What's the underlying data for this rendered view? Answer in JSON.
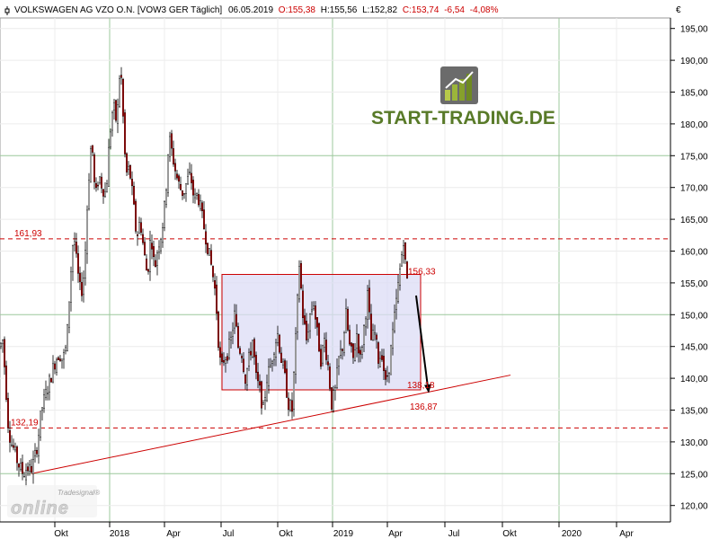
{
  "header": {
    "icon": "chart-icon",
    "instrument": "VOLKSWAGEN AG VZO O.N. [VOW3 GER  Täglich]",
    "date": "06.05.2019",
    "open": "O:155,38",
    "high": "H:155,56",
    "low": "L:152,82",
    "close": "C:153,74",
    "change": "-6,54",
    "change_pct": "-4,08%"
  },
  "currency_symbol": "€",
  "logo": {
    "text": "START-TRADING.DE"
  },
  "watermark": {
    "small": "Tradesignal®",
    "big": "online"
  },
  "colors": {
    "candle_up": "#ffffff",
    "candle_down": "#cc0000",
    "level": "#cc0000",
    "channel_fill": "#dcdcf5",
    "arrow": "#000000"
  },
  "chart_data": {
    "type": "candlestick",
    "ylim": [
      118,
      198
    ],
    "y_ticks": [
      "120,00",
      "125,00",
      "130,00",
      "135,00",
      "140,00",
      "145,00",
      "150,00",
      "155,00",
      "160,00",
      "165,00",
      "170,00",
      "175,00",
      "180,00",
      "185,00",
      "190,00",
      "195,00"
    ],
    "x_ticks": [
      "Okt",
      "2018",
      "Apr",
      "Jul",
      "Okt",
      "2019",
      "Apr",
      "Jul",
      "Okt",
      "2020",
      "Apr"
    ],
    "levels": [
      {
        "label": "161,93",
        "value": 161.93
      },
      {
        "label": "132,19",
        "value": 132.19
      }
    ],
    "channel": {
      "top_label": "156,33",
      "top": 156.33,
      "bottom_label": "138,18",
      "bottom": 138.18
    },
    "trendline_label": "136,87",
    "trendline": {
      "start": 125,
      "end": 140.5
    },
    "projection": {
      "from": 153,
      "to": 137.8
    },
    "price_path": [
      [
        0,
        145
      ],
      [
        3,
        146
      ],
      [
        6,
        140
      ],
      [
        9,
        133
      ],
      [
        12,
        130
      ],
      [
        15,
        129
      ],
      [
        18,
        127.5
      ],
      [
        22,
        126
      ],
      [
        26,
        125
      ],
      [
        30,
        126
      ],
      [
        34,
        125.5
      ],
      [
        38,
        127
      ],
      [
        42,
        130
      ],
      [
        46,
        135
      ],
      [
        50,
        137
      ],
      [
        54,
        139
      ],
      [
        58,
        141
      ],
      [
        62,
        143
      ],
      [
        66,
        144
      ],
      [
        70,
        143
      ],
      [
        74,
        145
      ],
      [
        78,
        155
      ],
      [
        82,
        163
      ],
      [
        86,
        157
      ],
      [
        90,
        153
      ],
      [
        94,
        157
      ],
      [
        98,
        170
      ],
      [
        102,
        178
      ],
      [
        106,
        168
      ],
      [
        110,
        172
      ],
      [
        114,
        170
      ],
      [
        118,
        169
      ],
      [
        122,
        178
      ],
      [
        126,
        183
      ],
      [
        130,
        180
      ],
      [
        134,
        190
      ],
      [
        137,
        181
      ],
      [
        140,
        172
      ],
      [
        144,
        173
      ],
      [
        148,
        168
      ],
      [
        152,
        162
      ],
      [
        156,
        165
      ],
      [
        160,
        160
      ],
      [
        164,
        156
      ],
      [
        168,
        163
      ],
      [
        172,
        157
      ],
      [
        176,
        161
      ],
      [
        180,
        163
      ],
      [
        184,
        168
      ],
      [
        188,
        178
      ],
      [
        192,
        175
      ],
      [
        196,
        172
      ],
      [
        200,
        170
      ],
      [
        204,
        169
      ],
      [
        208,
        171
      ],
      [
        212,
        172
      ],
      [
        216,
        168
      ],
      [
        220,
        169
      ],
      [
        224,
        166
      ],
      [
        228,
        163
      ],
      [
        232,
        160
      ],
      [
        236,
        157
      ],
      [
        240,
        153
      ],
      [
        243,
        146
      ],
      [
        246,
        141
      ],
      [
        249,
        143
      ],
      [
        253,
        144
      ],
      [
        257,
        146
      ],
      [
        261,
        150
      ],
      [
        265,
        145
      ],
      [
        269,
        144
      ],
      [
        273,
        140
      ],
      [
        277,
        143
      ],
      [
        281,
        146
      ],
      [
        285,
        140
      ],
      [
        289,
        138
      ],
      [
        293,
        135
      ],
      [
        297,
        140
      ],
      [
        301,
        142
      ],
      [
        305,
        145
      ],
      [
        309,
        147
      ],
      [
        313,
        143
      ],
      [
        317,
        140
      ],
      [
        321,
        136
      ],
      [
        325,
        135
      ],
      [
        329,
        146
      ],
      [
        333,
        158
      ],
      [
        337,
        150
      ],
      [
        341,
        146
      ],
      [
        345,
        150
      ],
      [
        349,
        152
      ],
      [
        353,
        147
      ],
      [
        357,
        143
      ],
      [
        361,
        146
      ],
      [
        365,
        142
      ],
      [
        369,
        136
      ],
      [
        373,
        138
      ],
      [
        377,
        143
      ],
      [
        381,
        145
      ],
      [
        385,
        150
      ],
      [
        389,
        145
      ],
      [
        393,
        143
      ],
      [
        397,
        147
      ],
      [
        401,
        143
      ],
      [
        405,
        148
      ],
      [
        409,
        153
      ],
      [
        413,
        146
      ],
      [
        417,
        147
      ],
      [
        421,
        143
      ],
      [
        425,
        144
      ],
      [
        429,
        139
      ],
      [
        433,
        142
      ],
      [
        437,
        147
      ],
      [
        441,
        152
      ],
      [
        445,
        157
      ],
      [
        449,
        162
      ],
      [
        452,
        156
      ],
      [
        454,
        155
      ]
    ],
    "last_value": 153.74
  }
}
